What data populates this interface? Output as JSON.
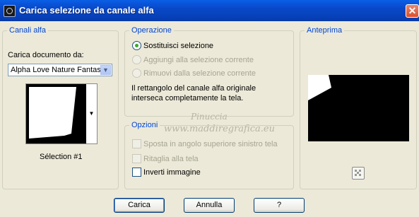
{
  "window": {
    "title": "Carica selezione da canale alfa",
    "close_icon": "close-icon"
  },
  "canali": {
    "legend": "Canali alfa",
    "doc_label": "Carica documento da:",
    "doc_value": "Alpha Love Nature Fantasy",
    "selection_name": "Sélection #1"
  },
  "operazione": {
    "legend": "Operazione",
    "options": [
      {
        "label": "Sostituisci selezione",
        "selected": true,
        "enabled": true
      },
      {
        "label": "Aggiungi alla selezione corrente",
        "selected": false,
        "enabled": false
      },
      {
        "label": "Rimuovi dalla selezione corrente",
        "selected": false,
        "enabled": false
      }
    ],
    "note_line1": "Il rettangolo del canale alfa originale",
    "note_line2": "interseca completamente la tela."
  },
  "watermark": {
    "name": "Pinuccia",
    "url": "www.maddiregrafica.eu"
  },
  "opzioni": {
    "legend": "Opzioni",
    "checks": [
      {
        "label": "Sposta in angolo superiore sinistro tela",
        "checked": false,
        "enabled": false
      },
      {
        "label": "Ritaglia alla tela",
        "checked": false,
        "enabled": false
      },
      {
        "label": "Inverti immagine",
        "checked": false,
        "enabled": true
      }
    ]
  },
  "anteprima": {
    "legend": "Anteprima"
  },
  "buttons": {
    "ok": "Carica",
    "cancel": "Annulla",
    "help": "?"
  },
  "colors": {
    "titlebar": "#0a5fe6",
    "legend": "#0046d5",
    "dialog_bg": "#ece9d8"
  }
}
